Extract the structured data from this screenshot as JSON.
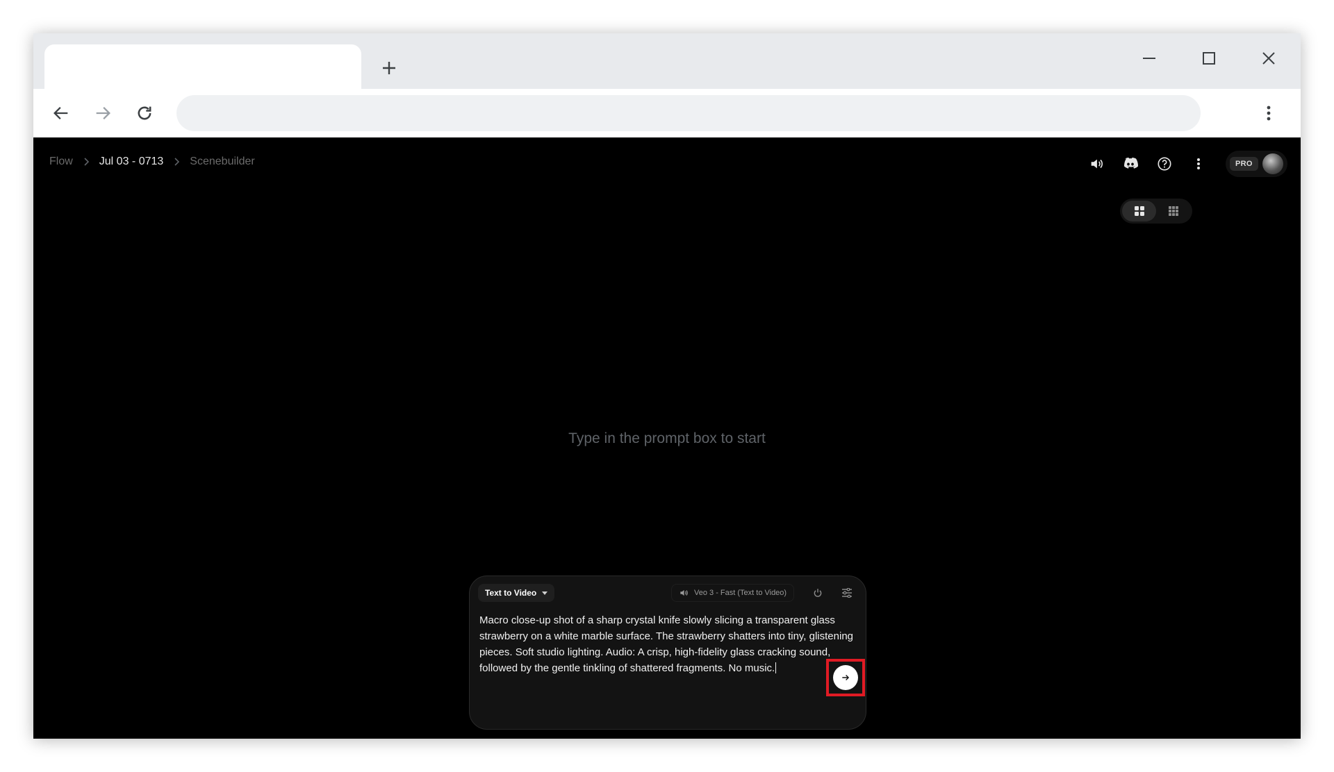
{
  "browser": {
    "tab_title": "",
    "address": ""
  },
  "app": {
    "breadcrumb": [
      "Flow",
      "Jul 03 - 0713",
      "Scenebuilder"
    ],
    "pro_label": "PRO",
    "empty_hint": "Type in the prompt box to start",
    "prompt": {
      "mode_label": "Text to Video",
      "model_label": "Veo 3 - Fast (Text to Video)",
      "text": "Macro close-up shot of a sharp crystal knife slowly slicing a transparent glass strawberry on a white marble surface. The strawberry shatters into tiny, glistening pieces. Soft studio lighting. Audio: A crisp, high-fidelity glass cracking sound, followed by the gentle tinkling of shattered fragments. No music."
    }
  },
  "icons": {
    "top": [
      "volume-icon",
      "discord-icon",
      "help-icon",
      "more-vert-icon"
    ],
    "view": [
      "grid-large-icon",
      "grid-small-icon"
    ]
  },
  "colors": {
    "app_bg": "#000000",
    "prompt_bg": "#131313",
    "highlight": "#e01b24"
  }
}
